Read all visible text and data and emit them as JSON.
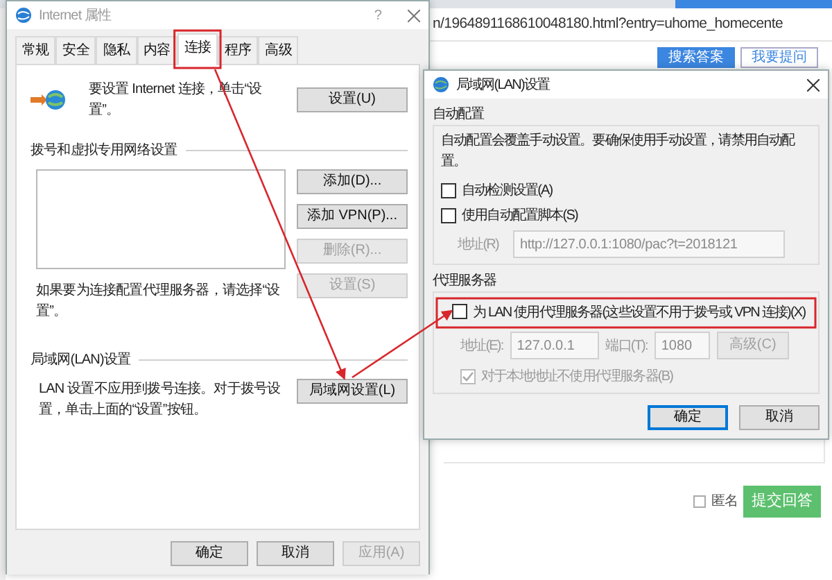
{
  "browser": {
    "address": "n/1964891168610048180.html?entry=uhome_homecente",
    "buttons": [
      {
        "label": "搜索答案",
        "kind": "primary"
      },
      {
        "label": "我要提问",
        "kind": "outline"
      }
    ],
    "anonymous": {
      "label": "匿名",
      "checked": false
    },
    "submit_button": "提交回答"
  },
  "internet_properties": {
    "title": "Internet 属性",
    "help": "?",
    "tabs": [
      {
        "label": "常规",
        "selected": false
      },
      {
        "label": "安全",
        "selected": false
      },
      {
        "label": "隐私",
        "selected": false
      },
      {
        "label": "内容",
        "selected": false
      },
      {
        "label": "连接",
        "selected": true
      },
      {
        "label": "程序",
        "selected": false
      },
      {
        "label": "高级",
        "selected": false
      }
    ],
    "setup_text": "要设置 Internet 连接，单击“设置”。",
    "setup_button": "设置(U)",
    "dialup_heading": "拨号和虚拟专用网络设置",
    "dialup_buttons": [
      {
        "label": "添加(D)...",
        "disabled": false
      },
      {
        "label": "添加 VPN(P)...",
        "disabled": false
      },
      {
        "label": "删除(R)...",
        "disabled": true
      },
      {
        "label": "设置(S)",
        "disabled": true
      }
    ],
    "proxy_hint": "如果要为连接配置代理服务器，请选择“设置”。",
    "lan_heading": "局域网(LAN)设置",
    "lan_text": "LAN 设置不应用到拨号连接。对于拨号设置，单击上面的“设置”按钮。",
    "lan_button": "局域网设置(L)",
    "footer_buttons": [
      {
        "label": "确定",
        "disabled": false
      },
      {
        "label": "取消",
        "disabled": false
      },
      {
        "label": "应用(A)",
        "disabled": true
      }
    ]
  },
  "lan_settings": {
    "title": "局域网(LAN)设置",
    "auto_heading": "自动配置",
    "auto_text": "自动配置会覆盖手动设置。要确保使用手动设置，请禁用自动配置。",
    "auto_options": [
      {
        "label": "自动检测设置(A)",
        "checked": false
      },
      {
        "label": "使用自动配置脚本(S)",
        "checked": false
      }
    ],
    "script_address": {
      "label": "地址(R)",
      "value": "http://127.0.0.1:1080/pac?t=2018121",
      "disabled": true
    },
    "proxy_heading": "代理服务器",
    "proxy_option": {
      "label": "为 LAN 使用代理服务器(这些设置不用于拨号或 VPN 连接)(X)",
      "checked": false
    },
    "proxy_address": {
      "label": "地址(E):",
      "value": "127.0.0.1",
      "disabled": true
    },
    "port": {
      "label": "端口(T):",
      "value": "1080",
      "disabled": true
    },
    "advanced_button": {
      "label": "高级(C)",
      "disabled": true
    },
    "bypass_local": {
      "label": "对于本地地址不使用代理服务器(B)",
      "checked": true,
      "disabled": true
    },
    "buttons": [
      {
        "label": "确定",
        "default": true
      },
      {
        "label": "取消",
        "default": false
      }
    ]
  }
}
